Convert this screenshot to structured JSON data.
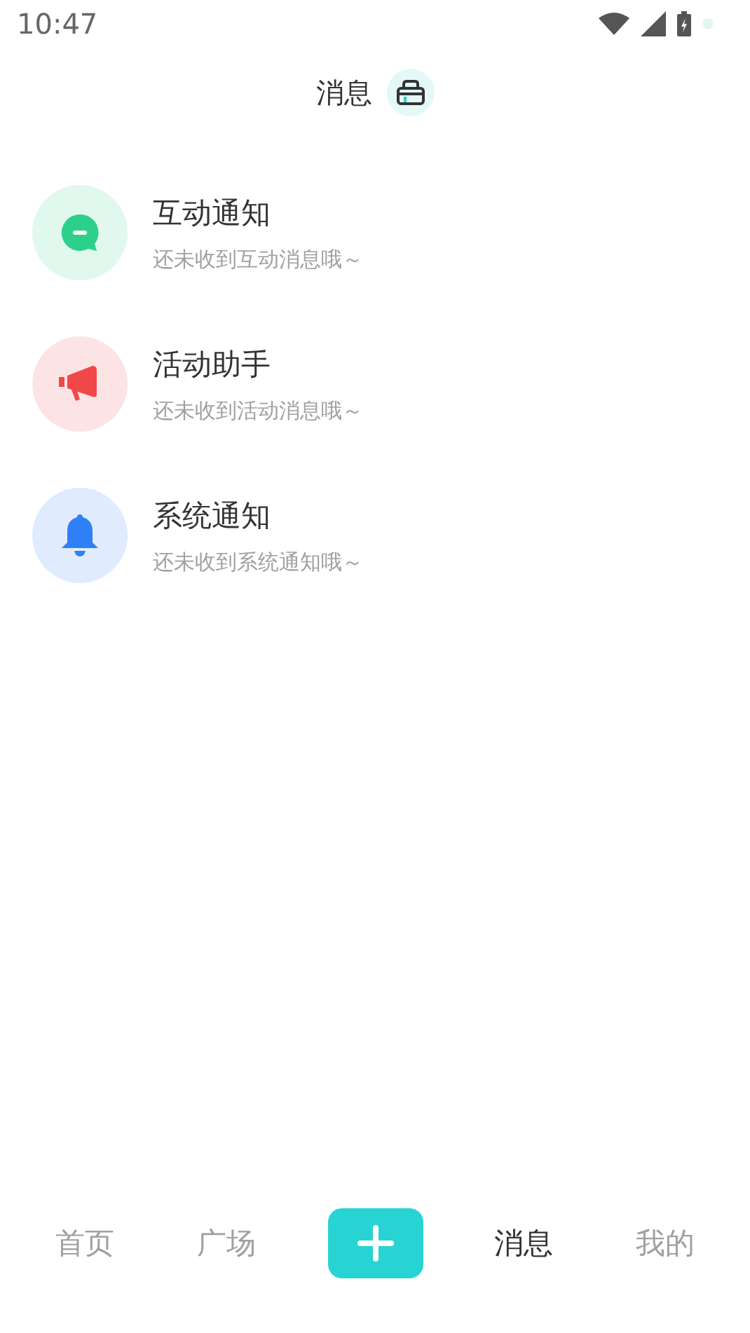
{
  "status_bar": {
    "time": "10:47"
  },
  "header": {
    "title": "消息"
  },
  "notifications": [
    {
      "kind": "chat",
      "color": "#2dd08a",
      "title": "互动通知",
      "subtitle": "还未收到互动消息哦～"
    },
    {
      "kind": "megaphone",
      "color": "#f04848",
      "title": "活动助手",
      "subtitle": "还未收到活动消息哦～"
    },
    {
      "kind": "bell",
      "color": "#2f7ff5",
      "title": "系统通知",
      "subtitle": "还未收到系统通知哦～"
    }
  ],
  "nav": [
    {
      "kind": "text",
      "label": "首页",
      "selected": false
    },
    {
      "kind": "text",
      "label": "广场",
      "selected": false
    },
    {
      "kind": "add",
      "selected": false
    },
    {
      "kind": "text",
      "label": "消息",
      "selected": true
    },
    {
      "kind": "text",
      "label": "我的",
      "selected": false
    }
  ]
}
